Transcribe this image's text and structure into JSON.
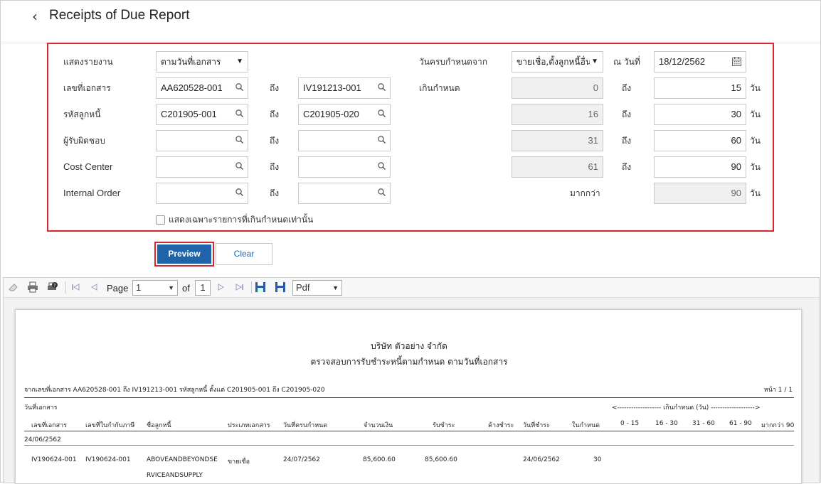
{
  "header": {
    "title": "Receipts of Due Report"
  },
  "filter": {
    "report_label": "แสดงรายงาน",
    "report_value": "ตามวันที่เอกสาร",
    "doc_label": "เลขที่เอกสาร",
    "doc_from": "AA620528-001",
    "doc_to": "IV191213-001",
    "debtor_label": "รหัสลูกหนี้",
    "debtor_from": "C201905-001",
    "debtor_to": "C201905-020",
    "resp_label": "ผู้รับผิดชอบ",
    "cc_label": "Cost Center",
    "io_label": "Internal Order",
    "to_label": "ถึง",
    "due_from_label": "วันครบกำหนดจาก",
    "due_from_value": "ขายเชื่อ,ตั้งลูกหนี้อื่น",
    "as_of_label": "ณ วันที่",
    "as_of_value": "18/12/2562",
    "overdue_label": "เกินกำหนด",
    "more_label": "มากกว่า",
    "day_unit": "วัน",
    "ranges": [
      {
        "from": "0",
        "to": "15"
      },
      {
        "from": "16",
        "to": "30"
      },
      {
        "from": "31",
        "to": "60"
      },
      {
        "from": "61",
        "to": "90"
      }
    ],
    "more_value": "90",
    "checkbox_label": "แสดงเฉพาะรายการที่เกินกำหนดเท่านั้น"
  },
  "buttons": {
    "preview": "Preview",
    "clear": "Clear"
  },
  "toolbar": {
    "page_label": "Page",
    "page_value": "1",
    "of_label": "of",
    "page_total": "1",
    "format_value": "Pdf"
  },
  "report": {
    "company": "บริษัท ตัวอย่าง จำกัด",
    "subtitle": "ตรวจสอบการรับชำระหนี้ตามกำหนด ตามวันที่เอกสาร",
    "criteria": "จากเลขที่เอกสาร AA620528-001 ถึง IV191213-001 รหัสลูกหนี้ ตั้งแต่ C201905-001 ถึง C201905-020",
    "page_no": "หน้า 1 / 1",
    "col_group": "วันที่เอกสาร",
    "overdue_header": "<------------------- เกินกำหนด (วัน) ------------------->",
    "columns": [
      "เลขที่เอกสาร",
      "เลขที่ใบกำกับภาษี",
      "ชื่อลูกหนี้",
      "ประเภทเอกสาร",
      "วันที่ครบกำหนด",
      "จำนวนเงิน",
      "รับชำระ",
      "ค้างชำระ",
      "วันที่ชำระ",
      "ในกำหนด",
      "0 - 15",
      "16 - 30",
      "31 - 60",
      "61 - 90",
      "มากกว่า 90"
    ],
    "group_date": "24/06/2562",
    "row": {
      "doc": "IV190624-001",
      "tax": "IV190624-001",
      "name1": "ABOVEANDBEYONDSE",
      "name2": "RVICEANDSUPPLY",
      "type": "ขายเชื่อ",
      "due": "24/07/2562",
      "amount": "85,600.60",
      "paid": "85,600.60",
      "pay_date": "24/06/2562",
      "in_due": "30"
    }
  }
}
